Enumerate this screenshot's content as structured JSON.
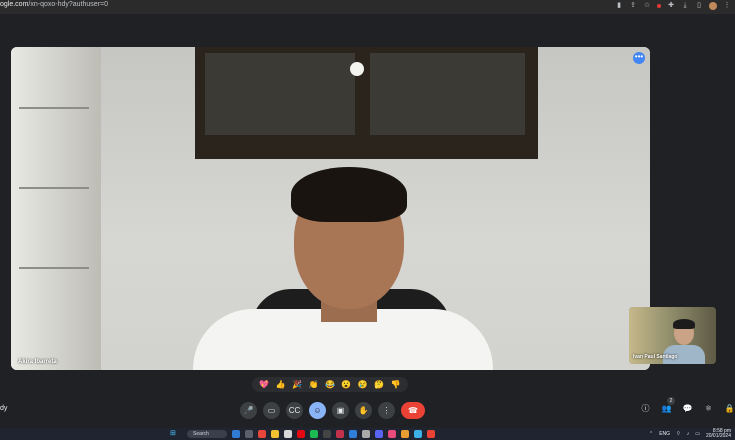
{
  "browser": {
    "url_host": "ogle.com",
    "url_path": "/xn-qoxo-hdy?authuser=0"
  },
  "meeting": {
    "main_participant": "Akira Ibarreta",
    "self_participant": "Ivan Paul Santiago",
    "more_options_icon": "•••",
    "meeting_code_partial": "dy",
    "participant_count": "2"
  },
  "reactions": [
    "💖",
    "👍",
    "🎉",
    "👏",
    "😂",
    "😮",
    "😢",
    "🤔",
    "👎"
  ],
  "controls": {
    "mic": "🎤",
    "camera": "▭",
    "captions": "CC",
    "emoji": "☺",
    "present": "▣",
    "raise_hand": "✋",
    "more": "⋮",
    "leave": "☎"
  },
  "right_controls": {
    "info": "ⓘ",
    "people": "👥",
    "chat": "💬",
    "activities": "⚛",
    "host": "🔒"
  },
  "taskbar": {
    "search_label": "Search",
    "language": "ENG",
    "region": "US",
    "time": "8:58 pm",
    "date": "20/01/2024"
  },
  "colors": {
    "accent": "#8ab4f8",
    "leave": "#ea4335",
    "more_dot": "#4285f4"
  }
}
